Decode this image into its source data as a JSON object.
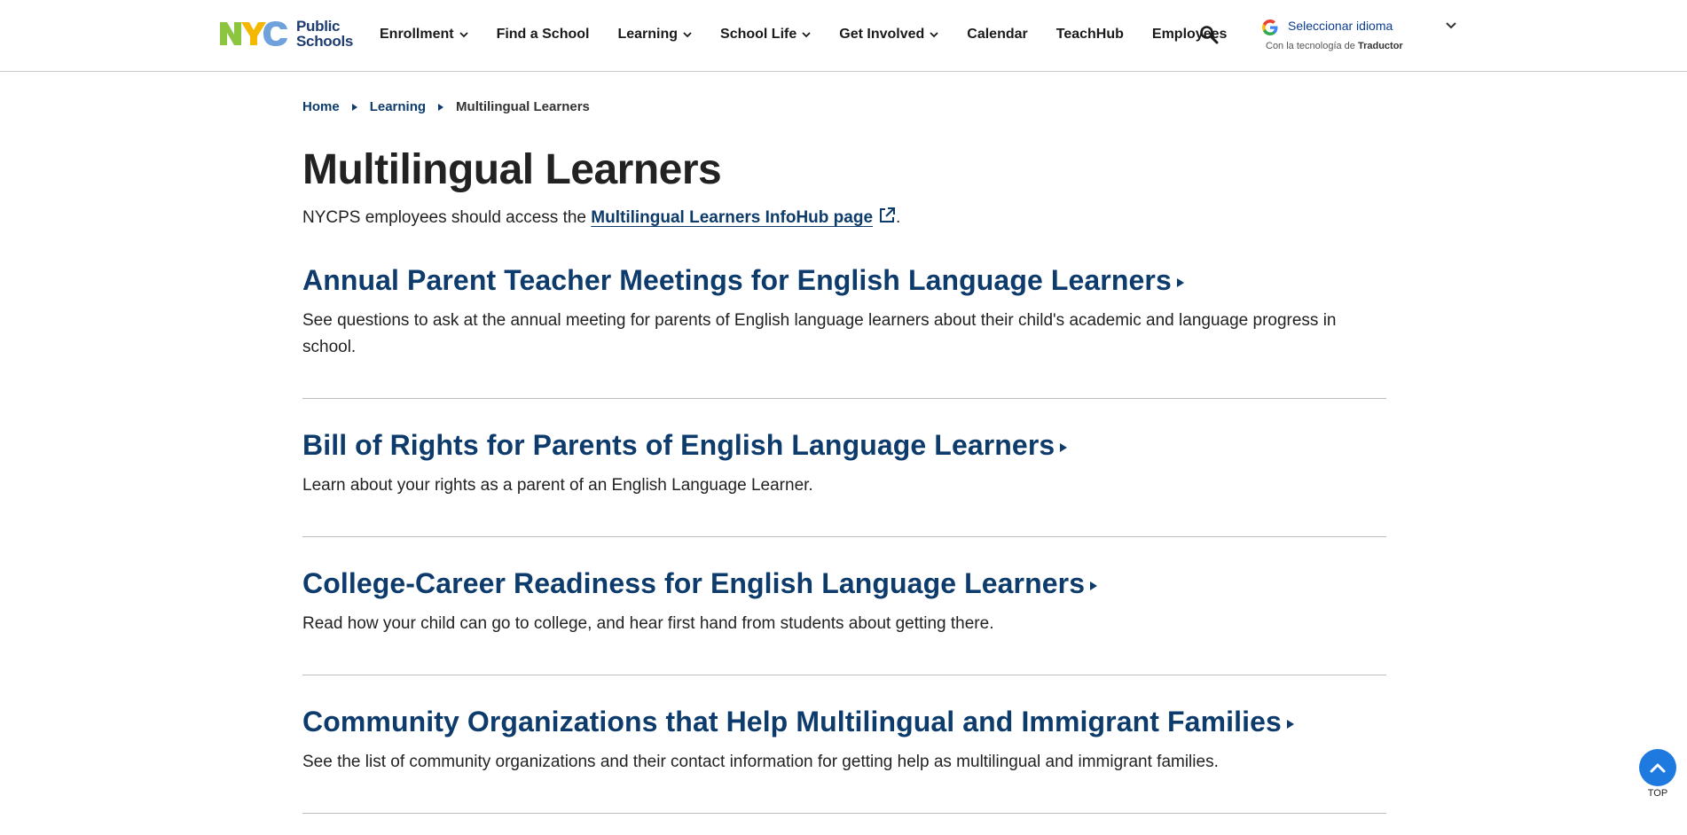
{
  "header": {
    "logo": {
      "line1": "Public",
      "line2": "Schools",
      "mark": "NYC"
    },
    "nav": [
      {
        "label": "Enrollment",
        "has_dropdown": true
      },
      {
        "label": "Find a School",
        "has_dropdown": false
      },
      {
        "label": "Learning",
        "has_dropdown": true
      },
      {
        "label": "School Life",
        "has_dropdown": true
      },
      {
        "label": "Get Involved",
        "has_dropdown": true
      },
      {
        "label": "Calendar",
        "has_dropdown": false
      },
      {
        "label": "TeachHub",
        "has_dropdown": false
      },
      {
        "label": "Employees",
        "has_dropdown": false
      }
    ],
    "search_icon": "search-icon",
    "translate": {
      "select_label": "Seleccionar idioma",
      "powered_prefix": "Con la tecnología de",
      "powered_brand": "Traductor"
    }
  },
  "breadcrumb": {
    "home": "Home",
    "learning": "Learning",
    "current": "Multilingual Learners"
  },
  "page": {
    "title": "Multilingual Learners",
    "intro_prefix": "NYCPS employees should access the",
    "intro_link": "Multilingual Learners InfoHub page",
    "intro_suffix": "."
  },
  "sections": [
    {
      "title": "Annual Parent Teacher Meetings for English Language Learners",
      "description": "See questions to ask at the annual meeting for parents of English language learners about their child's academic and language progress in school."
    },
    {
      "title": "Bill of Rights for Parents of English Language Learners",
      "description": "Learn about your rights as a parent of an English Language Learner."
    },
    {
      "title": "College-Career Readiness for English Language Learners",
      "description": "Read how your child can go to college, and hear first hand from students about getting there."
    },
    {
      "title": "Community Organizations that Help Multilingual and Immigrant Families",
      "description": "See the list of community organizations and their contact information for getting help as multilingual and immigrant families."
    }
  ],
  "back_to_top": {
    "label": "TOP"
  },
  "colors": {
    "link_blue": "#0d3b6b",
    "top_button": "#1f7ae0",
    "logo_green": "#8cc63f",
    "logo_yellow": "#f5b700",
    "logo_blue": "#6fa2dc"
  }
}
